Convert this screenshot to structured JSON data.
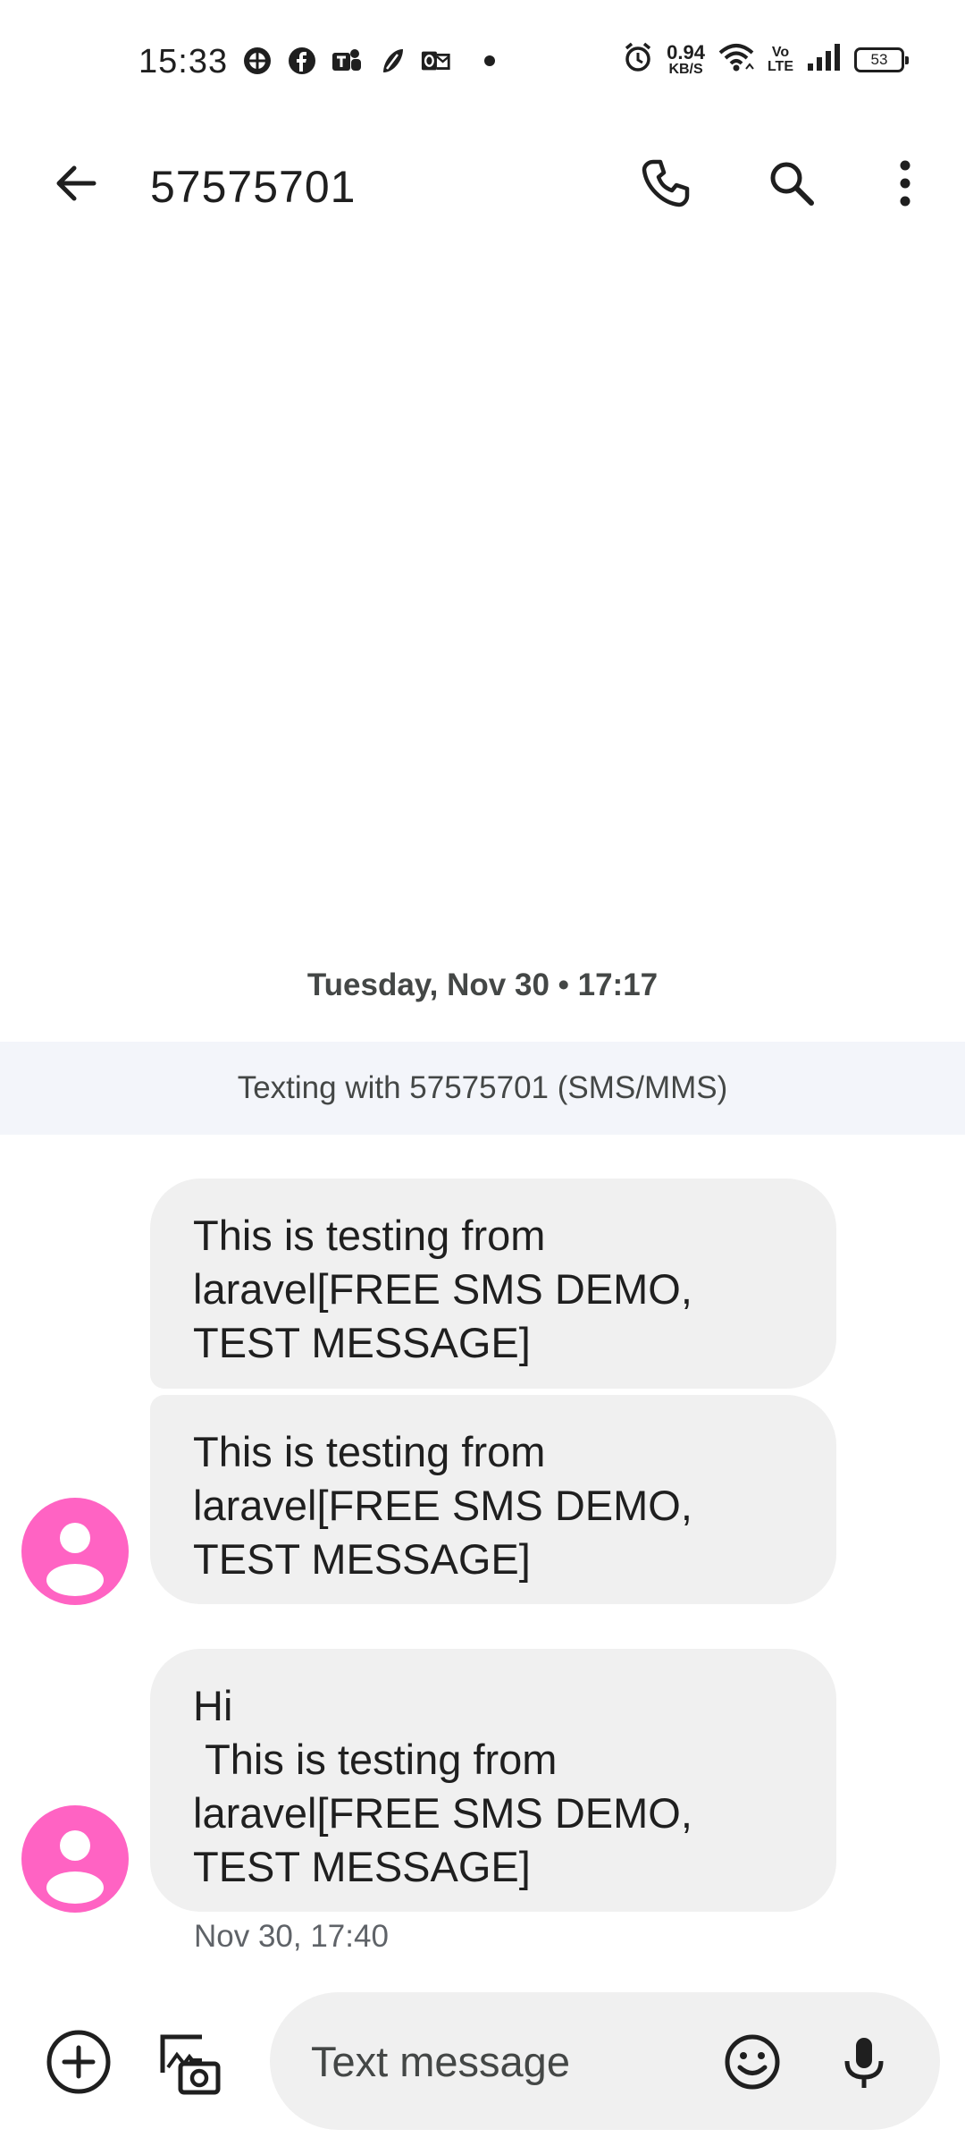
{
  "status_bar": {
    "time": "15:33",
    "net_speed_value": "0.94",
    "net_speed_unit": "KB/S",
    "volte_top": "Vo",
    "volte_bottom": "LTE",
    "battery": "53",
    "app_icons": [
      "app-notification-icon",
      "facebook-icon",
      "teams-icon",
      "app-notification-icon",
      "outlook-icon"
    ]
  },
  "header": {
    "title": "57575701"
  },
  "conversation": {
    "date_header": "Tuesday, Nov 30 • 17:17",
    "banner": "Texting with 57575701 (SMS/MMS)",
    "messages": [
      {
        "text": "This is testing from laravel[FREE SMS DEMO, TEST MESSAGE]"
      },
      {
        "text": "This is testing from laravel[FREE SMS DEMO, TEST MESSAGE]"
      },
      {
        "text": "Hi\n This is testing from laravel[FREE SMS DEMO, TEST MESSAGE]"
      }
    ],
    "last_timestamp": "Nov 30, 17:40"
  },
  "compose": {
    "placeholder": "Text message"
  },
  "colors": {
    "avatar": "#ff63c3",
    "bubble": "#f0f0f0",
    "banner": "#f3f5fa"
  }
}
